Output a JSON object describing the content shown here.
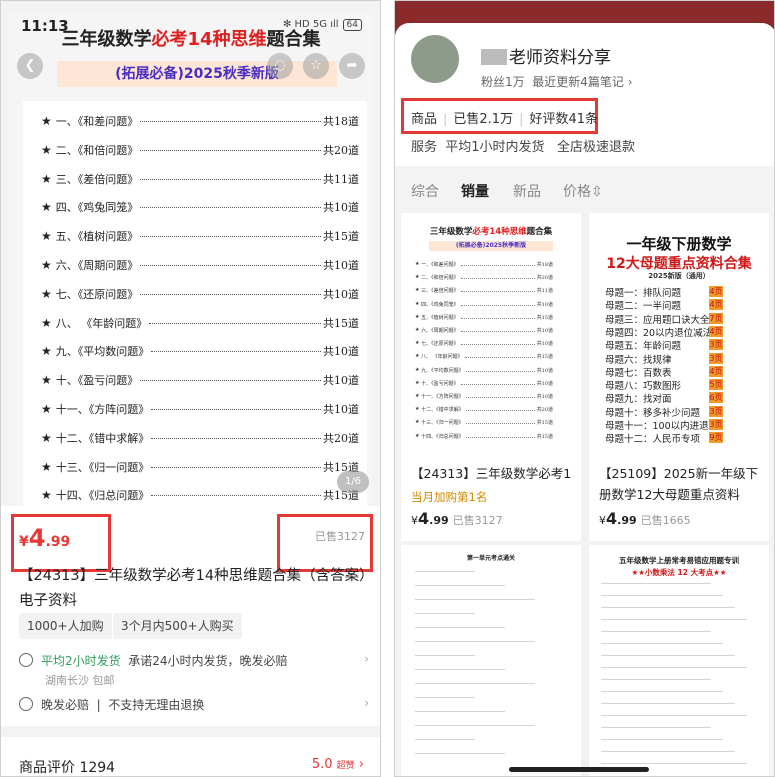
{
  "left": {
    "status": {
      "time": "11:13",
      "icons": "✻ HD 5G ıll",
      "battery": "64"
    },
    "cover": {
      "title_pre": "三年级数学",
      "title_red": "必考14种思维",
      "title_post": "题合集",
      "subtitle": "(拓展必备)2025秋季新版",
      "toc": [
        {
          "name": "一、《和差问题》",
          "count": "共18道"
        },
        {
          "name": "二、《和倍问题》",
          "count": "共20道"
        },
        {
          "name": "三、《差倍问题》",
          "count": "共11道"
        },
        {
          "name": "四、《鸡兔同笼》",
          "count": "共10道"
        },
        {
          "name": "五、《植树问题》",
          "count": "共15道"
        },
        {
          "name": "六、《周期问题》",
          "count": "共10道"
        },
        {
          "name": "七、《还原问题》",
          "count": "共10道"
        },
        {
          "name": "八、 《年龄问题》",
          "count": "共15道"
        },
        {
          "name": "九、《平均数问题》",
          "count": "共10道"
        },
        {
          "name": "十、《盈亏问题》",
          "count": "共10道"
        },
        {
          "name": "十一、《方阵问题》",
          "count": "共10道"
        },
        {
          "name": "十二、《错中求解》",
          "count": "共20道"
        },
        {
          "name": "十三、《归一问题》",
          "count": "共15道"
        },
        {
          "name": "十四、《归总问题》",
          "count": "共15道"
        }
      ],
      "pager": "1/6"
    },
    "product": {
      "currency": "¥",
      "price_int": "4",
      "price_dec": ".99",
      "sold": "已售3127",
      "title": "【24313】三年级数学必考14种思维题合集（含答案）电子资料",
      "chips": [
        "1000+人加购",
        "3个月内500+人购买"
      ],
      "ship_highlight": "平均2小时发货",
      "ship_text": "承诺24小时内发货，晚发必赔",
      "ship_from": "湖南长沙 包邮",
      "guarantee": "晚发必赔",
      "guarantee_text": "不支持无理由退换"
    },
    "review": {
      "label": "商品评价 1294",
      "score": "5.0",
      "score_tag": "超赞"
    }
  },
  "right": {
    "shop": {
      "name": "老师资料分享",
      "fans": "粉丝1万",
      "update": "最近更新4篇笔记 ›"
    },
    "stats": {
      "label": "商品",
      "sold": "已售2.1万",
      "reviews": "好评数41条"
    },
    "service": {
      "label": "服务",
      "ship": "平均1小时内发货",
      "refund": "全店极速退款"
    },
    "tabs": [
      "综合",
      "销量",
      "新品",
      "价格⇳"
    ],
    "cards": [
      {
        "title": "【24313】三年级数学必考14种思维题合集",
        "rank": "当月加购第1名",
        "price_int": "4",
        "price_dec": ".99",
        "sold": "已售3127"
      },
      {
        "title": "【25109】2025新一年级下册数学12大母题重点资料",
        "price_int": "4",
        "price_dec": ".99",
        "sold": "已售1665",
        "cover_title1": "一年级下册数学",
        "cover_title2": "12大母题重点资料合集",
        "cover_sub": "2025新版（通用）",
        "items": [
          {
            "name": "母题一：排队问题",
            "tag": "4页"
          },
          {
            "name": "母题二：一半问题",
            "tag": "4页"
          },
          {
            "name": "母题三：应用题口诀大全",
            "tag": "7页"
          },
          {
            "name": "母题四：20以内退位减法",
            "tag": "4页"
          },
          {
            "name": "母题五：年龄问题",
            "tag": "3页"
          },
          {
            "name": "母题六：找规律",
            "tag": "3页"
          },
          {
            "name": "母题七：百数表",
            "tag": "4页"
          },
          {
            "name": "母题八：巧数图形",
            "tag": "5页"
          },
          {
            "name": "母题九：找对面",
            "tag": "6页"
          },
          {
            "name": "母题十：移多补少问题",
            "tag": "3页"
          },
          {
            "name": "母题十一：100以内进退位",
            "tag": "3页"
          },
          {
            "name": "母题十二：人民币专项",
            "tag": "9页"
          }
        ]
      },
      {
        "sheet_title": "第一单元考点通关"
      },
      {
        "sheet_title": "五年级数学上册常考易错应用题专训",
        "sheet_sub": "★★小数乘法 12 大考点★★"
      }
    ]
  }
}
